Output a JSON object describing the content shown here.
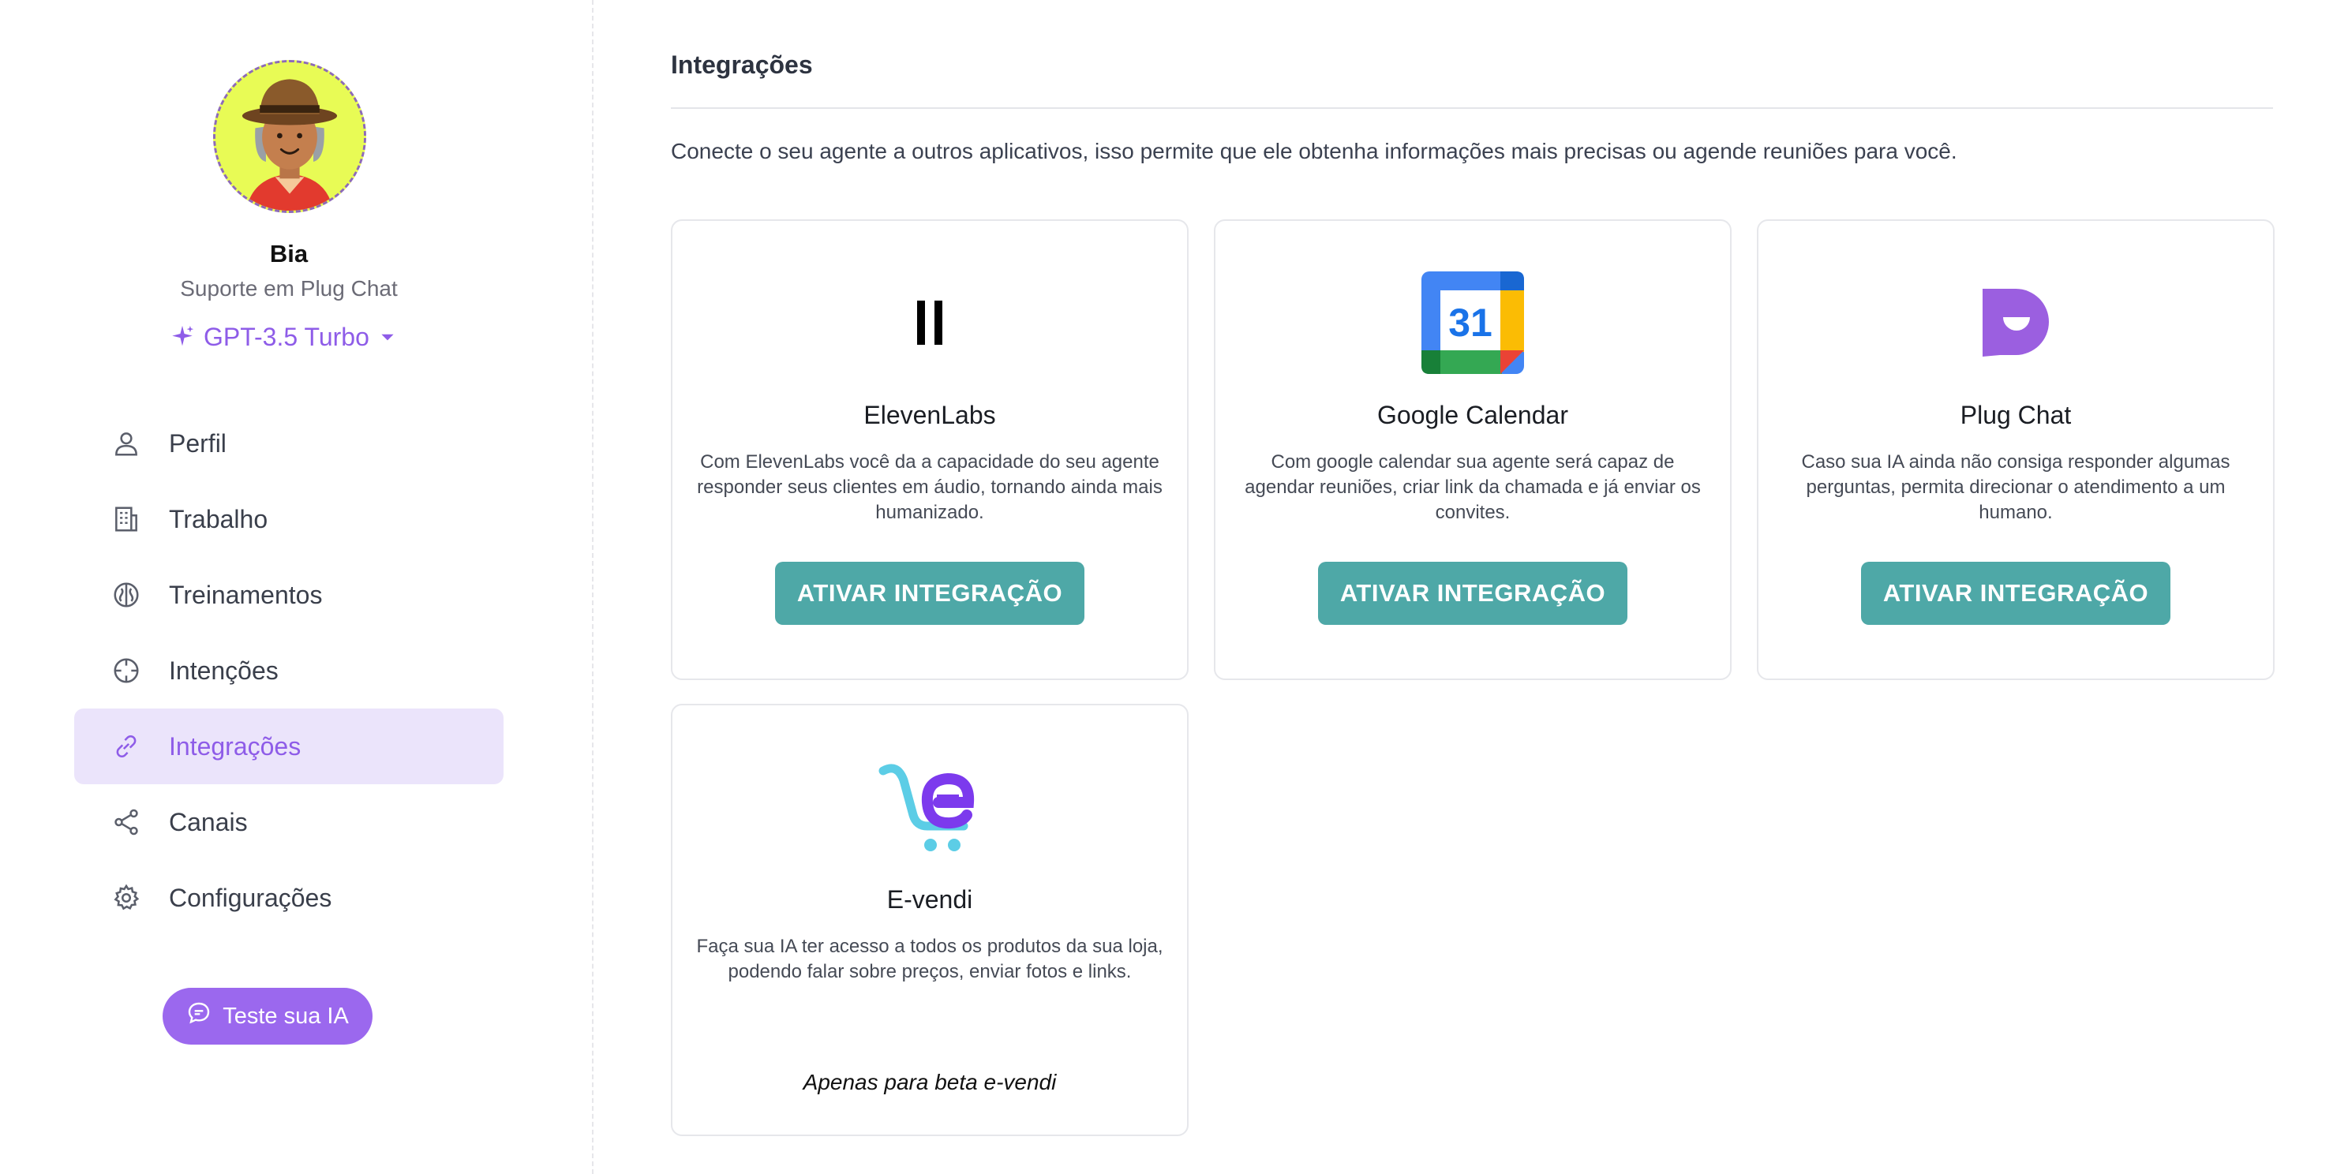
{
  "sidebar": {
    "agent": {
      "name": "Bia",
      "role": "Suporte em Plug Chat",
      "model": "GPT-3.5 Turbo"
    },
    "nav": [
      {
        "label": "Perfil",
        "icon": "user-icon",
        "active": false
      },
      {
        "label": "Trabalho",
        "icon": "building-icon",
        "active": false
      },
      {
        "label": "Treinamentos",
        "icon": "brain-icon",
        "active": false
      },
      {
        "label": "Intenções",
        "icon": "crosshair-icon",
        "active": false
      },
      {
        "label": "Integrações",
        "icon": "link-icon",
        "active": true
      },
      {
        "label": "Canais",
        "icon": "share-icon",
        "active": false
      },
      {
        "label": "Configurações",
        "icon": "gear-icon",
        "active": false
      }
    ],
    "test_button": "Teste sua IA"
  },
  "main": {
    "title": "Integrações",
    "description": "Conecte o seu agente a outros aplicativos, isso permite que ele obtenha informações mais precisas ou agende reuniões para você.",
    "integrations": [
      {
        "name": "ElevenLabs",
        "logo": "elevenlabs-logo",
        "description": "Com ElevenLabs você da a capacidade do seu agente responder seus clientes em áudio, tornando ainda mais humanizado.",
        "button": "ATIVAR INTEGRAÇÃO"
      },
      {
        "name": "Google Calendar",
        "logo": "google-calendar-logo",
        "logo_text": "31",
        "description": "Com google calendar sua agente será capaz de agendar reuniões, criar link da chamada e já enviar os convites.",
        "button": "ATIVAR INTEGRAÇÃO"
      },
      {
        "name": "Plug Chat",
        "logo": "plug-chat-logo",
        "description": "Caso sua IA ainda não consiga responder algumas perguntas, permita direcionar o atendimento a um humano.",
        "button": "ATIVAR INTEGRAÇÃO"
      },
      {
        "name": "E-vendi",
        "logo": "e-vendi-logo",
        "description": "Faça sua IA ter acesso a todos os produtos da sua loja, podendo falar sobre preços, enviar fotos e links.",
        "note": "Apenas para beta e-vendi"
      }
    ]
  },
  "colors": {
    "accent": "#9b68ee",
    "active_bg": "#ebe4fb",
    "button_teal": "#4ea8a7"
  }
}
